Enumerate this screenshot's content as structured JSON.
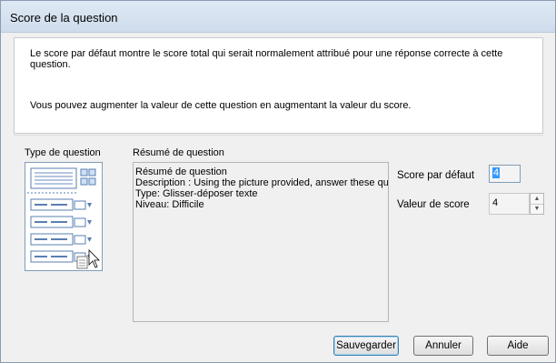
{
  "window": {
    "title": "Score de la question"
  },
  "info": {
    "line1": "Le score par défaut montre le score total qui serait normalement attribué pour une réponse correcte à cette question.",
    "line2": "Vous pouvez augmenter la valeur de cette question en augmentant la valeur du score."
  },
  "labels": {
    "question_type": "Type de question",
    "summary": "Résumé de question",
    "default_score": "Score par défaut",
    "score_value": "Valeur de score"
  },
  "summary": {
    "heading": "Résumé de question",
    "description": "Description : Using the picture provided, answer these que",
    "type": "Type: Glisser-déposer texte",
    "level": "Niveau: Difficile"
  },
  "fields": {
    "default_score": "4",
    "score_value": "4"
  },
  "buttons": {
    "save": "Sauvegarder",
    "cancel": "Annuler",
    "help": "Aide"
  },
  "icons": {
    "question_type": "drag-and-drop-text-icon",
    "spin_up": "arrow-up-icon",
    "spin_down": "arrow-down-icon"
  }
}
